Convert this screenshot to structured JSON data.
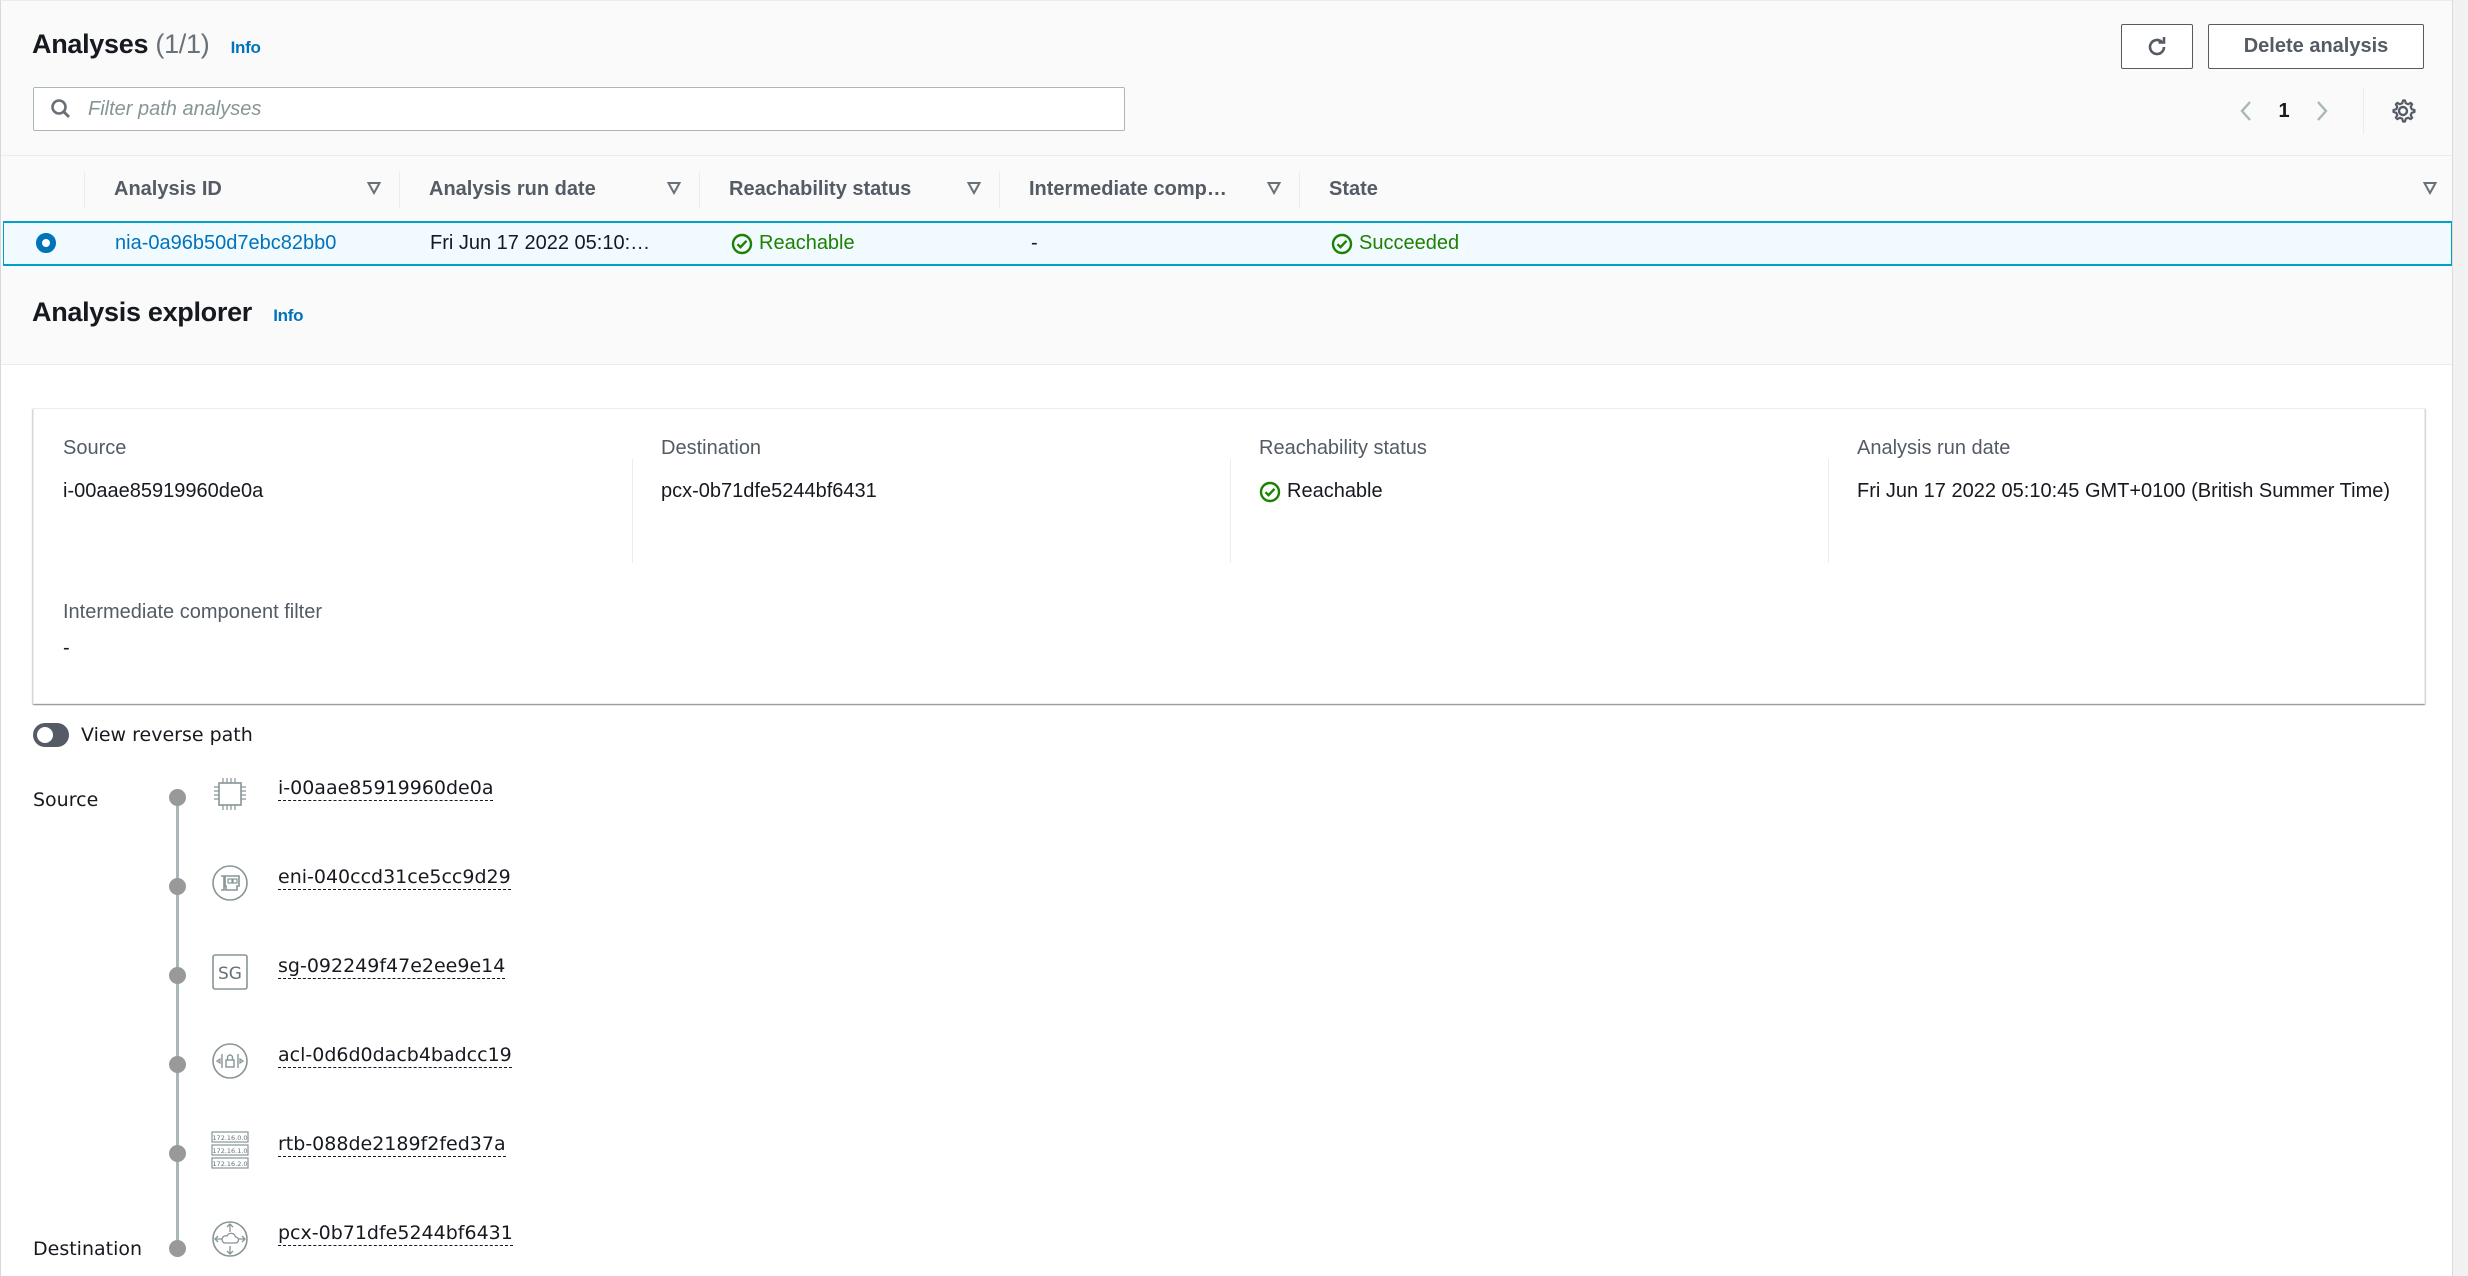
{
  "analyses": {
    "title": "Analyses",
    "count": "(1/1)",
    "info_label": "Info",
    "refresh_icon": "refresh-icon",
    "delete_label": "Delete analysis",
    "search": {
      "placeholder": "Filter path analyses",
      "value": ""
    },
    "pagination": {
      "current_page": "1",
      "prev_icon": "chevron-left-icon",
      "next_icon": "chevron-right-icon",
      "settings_icon": "gear-icon"
    },
    "columns": [
      {
        "label": "Analysis ID"
      },
      {
        "label": "Analysis run date"
      },
      {
        "label": "Reachability status"
      },
      {
        "label": "Intermediate comp…"
      },
      {
        "label": "State"
      }
    ],
    "rows": [
      {
        "selected": true,
        "analysis_id": "nia-0a96b50d7ebc82bb0",
        "run_date": "Fri Jun 17 2022 05:10:…",
        "reachability": "Reachable",
        "intermediate": "-",
        "state": "Succeeded"
      }
    ]
  },
  "explorer": {
    "title": "Analysis explorer",
    "info_label": "Info",
    "details": {
      "source_label": "Source",
      "source_value": "i-00aae85919960de0a",
      "destination_label": "Destination",
      "destination_value": "pcx-0b71dfe5244bf6431",
      "reachability_label": "Reachability status",
      "reachability_value": "Reachable",
      "run_date_label": "Analysis run date",
      "run_date_value": "Fri Jun 17 2022 05:10:45 GMT+0100 (British Summer Time)",
      "intermediate_label": "Intermediate component filter",
      "intermediate_value": "-"
    },
    "reverse_toggle": {
      "label": "View reverse path",
      "checked": false
    },
    "path": [
      {
        "role": "Source",
        "icon": "ec2-instance-icon",
        "id": "i-00aae85919960de0a"
      },
      {
        "role": "",
        "icon": "network-interface-icon",
        "id": "eni-040ccd31ce5cc9d29"
      },
      {
        "role": "",
        "icon": "security-group-icon",
        "id": "sg-092249f47e2ee9e14"
      },
      {
        "role": "",
        "icon": "network-acl-icon",
        "id": "acl-0d6d0dacb4badcc19"
      },
      {
        "role": "",
        "icon": "route-table-icon",
        "id": "rtb-088de2189f2fed37a"
      },
      {
        "role": "Destination",
        "icon": "peering-connection-icon",
        "id": "pcx-0b71dfe5244bf6431"
      }
    ],
    "icon_text": {
      "sg": "SG",
      "rtb_lines": [
        "172.16.0.0",
        "172.16.1.0",
        "172.16.2.0"
      ]
    }
  },
  "colors": {
    "link": "#0073bb",
    "success": "#1d8102",
    "selected_row_bg": "#f1faff",
    "selected_row_border": "#00a1c9"
  }
}
